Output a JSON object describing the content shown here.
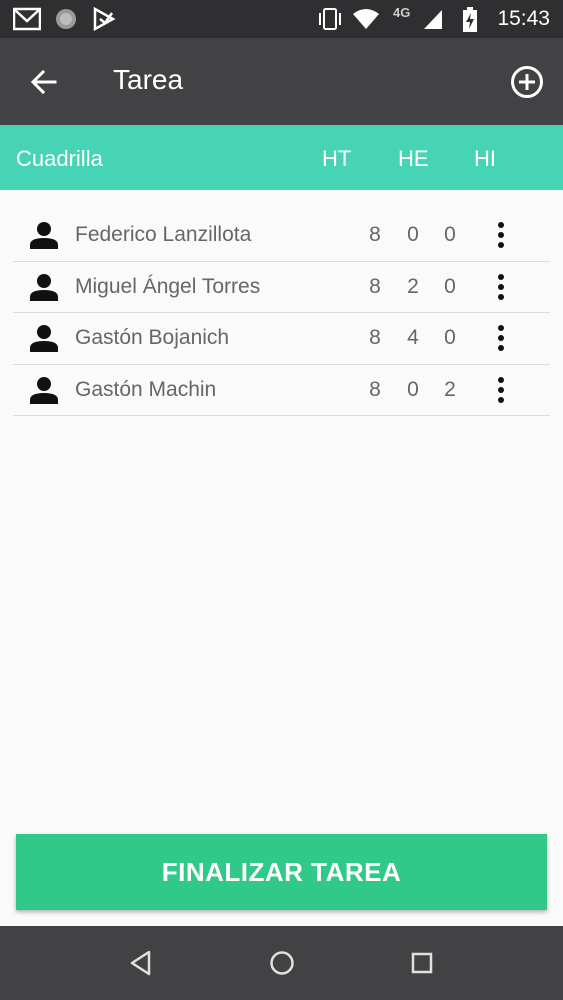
{
  "status_bar": {
    "time": "15:43",
    "network": "4G",
    "icons": [
      "gmail-icon",
      "circle-app-icon",
      "play-store-icon",
      "vibrate-icon",
      "wifi-icon",
      "signal-icon",
      "battery-charging-icon"
    ]
  },
  "app_bar": {
    "title": "Tarea",
    "back_icon": "arrow-back-icon",
    "add_icon": "add-circle-icon"
  },
  "header": {
    "name": "Cuadrilla",
    "ht": "HT",
    "he": "HE",
    "hi": "HI"
  },
  "workers": [
    {
      "name": "Federico Lanzillota",
      "ht": "8",
      "he": "0",
      "hi": "0"
    },
    {
      "name": "Miguel Ángel Torres",
      "ht": "8",
      "he": "2",
      "hi": "0"
    },
    {
      "name": "Gastón Bojanich",
      "ht": "8",
      "he": "4",
      "hi": "0"
    },
    {
      "name": "Gastón Machin",
      "ht": "8",
      "he": "0",
      "hi": "2"
    }
  ],
  "finish_button": "FINALIZAR TAREA",
  "colors": {
    "app_bar": "#424244",
    "header": "#47d4b5",
    "finish_button": "#31c98a",
    "status_bar": "#2f2f31"
  }
}
